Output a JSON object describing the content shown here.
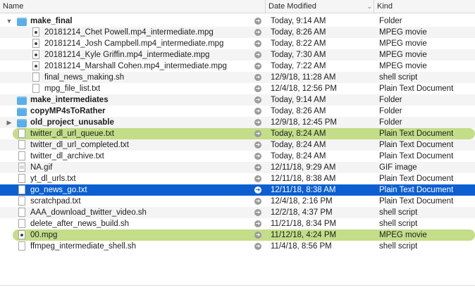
{
  "columns": {
    "name": "Name",
    "date": "Date Modified",
    "kind": "Kind"
  },
  "colors": {
    "selection": "#0b5fd1",
    "green_tag": "#c4dd89",
    "folder": "#5aaee9"
  },
  "rows": [
    {
      "name": "make_final",
      "date": "Today, 9:14 AM",
      "kind": "Folder",
      "icon": "folder",
      "level": 0,
      "disclosure": "open",
      "bold": true,
      "state": ""
    },
    {
      "name": "20181214_Chet Powell.mp4_intermediate.mpg",
      "date": "Today, 8:26 AM",
      "kind": "MPEG movie",
      "icon": "movie",
      "level": 1,
      "disclosure": "",
      "bold": false,
      "state": ""
    },
    {
      "name": "20181214_Josh Campbell.mp4_intermediate.mpg",
      "date": "Today, 8:22 AM",
      "kind": "MPEG movie",
      "icon": "movie",
      "level": 1,
      "disclosure": "",
      "bold": false,
      "state": ""
    },
    {
      "name": "20181214_Kyle Griffin.mp4_intermediate.mpg",
      "date": "Today, 7:30 AM",
      "kind": "MPEG movie",
      "icon": "movie",
      "level": 1,
      "disclosure": "",
      "bold": false,
      "state": ""
    },
    {
      "name": "20181214_Marshall Cohen.mp4_intermediate.mpg",
      "date": "Today, 7:22 AM",
      "kind": "MPEG movie",
      "icon": "movie",
      "level": 1,
      "disclosure": "",
      "bold": false,
      "state": ""
    },
    {
      "name": "final_news_making.sh",
      "date": "12/9/18, 11:28 AM",
      "kind": "shell script",
      "icon": "doc",
      "level": 1,
      "disclosure": "",
      "bold": false,
      "state": ""
    },
    {
      "name": "mpg_file_list.txt",
      "date": "12/4/18, 12:56 PM",
      "kind": "Plain Text Document",
      "icon": "doc",
      "level": 1,
      "disclosure": "",
      "bold": false,
      "state": ""
    },
    {
      "name": "make_intermediates",
      "date": "Today, 9:14 AM",
      "kind": "Folder",
      "icon": "folder",
      "level": 0,
      "disclosure": "",
      "bold": true,
      "state": ""
    },
    {
      "name": "copyMP4sToRather",
      "date": "Today, 8:26 AM",
      "kind": "Folder",
      "icon": "folder",
      "level": 0,
      "disclosure": "",
      "bold": true,
      "state": ""
    },
    {
      "name": "old_project_unusable",
      "date": "12/9/18, 12:45 PM",
      "kind": "Folder",
      "icon": "folder",
      "level": 0,
      "disclosure": "closed",
      "bold": true,
      "state": ""
    },
    {
      "name": "twitter_dl_url_queue.txt",
      "date": "Today, 8:24 AM",
      "kind": "Plain Text Document",
      "icon": "doc",
      "level": 0,
      "disclosure": "",
      "bold": false,
      "state": "tagged"
    },
    {
      "name": "twitter_dl_url_completed.txt",
      "date": "Today, 8:24 AM",
      "kind": "Plain Text Document",
      "icon": "doc",
      "level": 0,
      "disclosure": "",
      "bold": false,
      "state": ""
    },
    {
      "name": "twitter_dl_archive.txt",
      "date": "Today, 8:24 AM",
      "kind": "Plain Text Document",
      "icon": "doc",
      "level": 0,
      "disclosure": "",
      "bold": false,
      "state": ""
    },
    {
      "name": "NA.gif",
      "date": "12/11/18, 9:29 AM",
      "kind": "GIF image",
      "icon": "gif",
      "level": 0,
      "disclosure": "",
      "bold": false,
      "state": ""
    },
    {
      "name": "yt_dl_urls.txt",
      "date": "12/11/18, 8:38 AM",
      "kind": "Plain Text Document",
      "icon": "doc",
      "level": 0,
      "disclosure": "",
      "bold": false,
      "state": ""
    },
    {
      "name": "go_news_go.txt",
      "date": "12/11/18, 8:38 AM",
      "kind": "Plain Text Document",
      "icon": "doc",
      "level": 0,
      "disclosure": "",
      "bold": false,
      "state": "selected"
    },
    {
      "name": "scratchpad.txt",
      "date": "12/4/18, 2:16 PM",
      "kind": "Plain Text Document",
      "icon": "doc",
      "level": 0,
      "disclosure": "",
      "bold": false,
      "state": ""
    },
    {
      "name": "AAA_download_twitter_video.sh",
      "date": "12/2/18, 4:37 PM",
      "kind": "shell script",
      "icon": "doc",
      "level": 0,
      "disclosure": "",
      "bold": false,
      "state": ""
    },
    {
      "name": "delete_after_news_build.sh",
      "date": "11/21/18, 8:34 PM",
      "kind": "shell script",
      "icon": "doc",
      "level": 0,
      "disclosure": "",
      "bold": false,
      "state": ""
    },
    {
      "name": "00.mpg",
      "date": "11/12/18, 4:24 PM",
      "kind": "MPEG movie",
      "icon": "movie",
      "level": 0,
      "disclosure": "",
      "bold": false,
      "state": "tagged"
    },
    {
      "name": "ffmpeg_intermediate_shell.sh",
      "date": "11/4/18, 8:56 PM",
      "kind": "shell script",
      "icon": "doc",
      "level": 0,
      "disclosure": "",
      "bold": false,
      "state": ""
    }
  ]
}
